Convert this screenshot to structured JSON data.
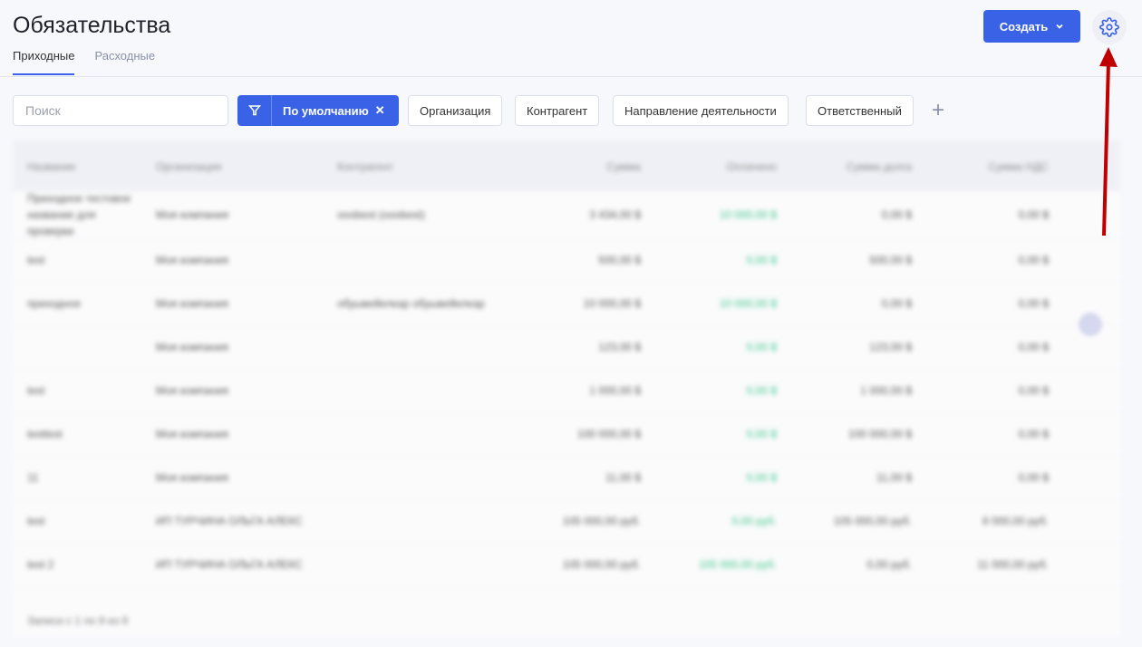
{
  "header": {
    "title": "Обязательства",
    "create_label": "Создать"
  },
  "tabs": [
    {
      "label": "Приходные"
    },
    {
      "label": "Расходные"
    }
  ],
  "filters": {
    "search_placeholder": "Поиск",
    "preset": "По умолчанию",
    "chips": [
      "Организация",
      "Контрагент",
      "Направление деятельности",
      "Ответственный"
    ]
  },
  "table": {
    "columns": [
      "Название",
      "Организация",
      "Контрагент",
      "Сумма",
      "Оплачено",
      "Сумма долга",
      "Сумма НДС"
    ],
    "rows": [
      [
        "Приходное тестовое название для проверки",
        "Моя компания",
        "ooobest (ooobest)",
        "3 434,00 $",
        "10 000,00 $",
        "0,00 $",
        "0,00 $"
      ],
      [
        "test",
        "Моя компания",
        "",
        "500,00 $",
        "0,00 $",
        "500,00 $",
        "0,00 $"
      ],
      [
        "приходное",
        "Моя компания",
        "обуывейелкар обуывейелкар",
        "10 000,00 $",
        "10 000,00 $",
        "0,00 $",
        "0,00 $"
      ],
      [
        "",
        "Моя компания",
        "",
        "123,00 $",
        "0,00 $",
        "123,00 $",
        "0,00 $"
      ],
      [
        "test",
        "Моя компания",
        "",
        "1 000,00 $",
        "0,00 $",
        "1 000,00 $",
        "0,00 $"
      ],
      [
        "testtest",
        "Моя компания",
        "",
        "100 000,00 $",
        "0,00 $",
        "100 000,00 $",
        "0,00 $"
      ],
      [
        "11",
        "Моя компания",
        "",
        "11,00 $",
        "0,00 $",
        "11,00 $",
        "0,00 $"
      ],
      [
        "test",
        "ИП ТУРЧИНА ОЛЬГА АЛЕКС",
        "",
        "105 000,00 руб.",
        "0,00 руб.",
        "105 000,00 руб.",
        "6 000,00 руб."
      ],
      [
        "test 2",
        "ИП ТУРЧИНА ОЛЬГА АЛЕКС",
        "",
        "105 000,00 руб.",
        "105 000,00 руб.",
        "0,00 руб.",
        "11 000,00 руб."
      ]
    ],
    "footer": "Записи с 1 по 9 из 9"
  },
  "colors": {
    "accent": "#3a62e6",
    "paid": "#39c48a",
    "annotation": "#c00000"
  }
}
